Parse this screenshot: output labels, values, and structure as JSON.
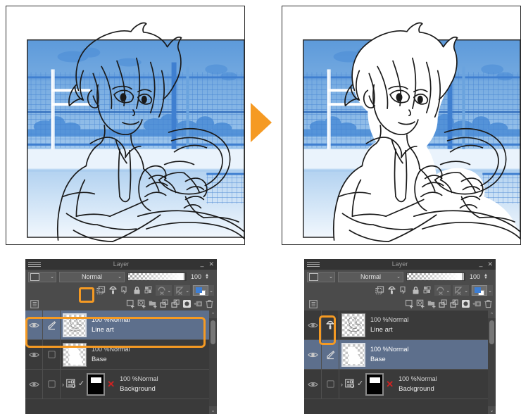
{
  "window": {
    "title": "Layer",
    "menu_icon": "hamburger-icon",
    "minimize_label": "–",
    "close_label": "✕"
  },
  "toolbar": {
    "blend_mode": "Normal",
    "opacity_value": "100",
    "chevron": "⌄",
    "row2_icons": [
      "lock-transparent-pixels-icon",
      "clipping-mask-icon",
      "layer-mask-link-icon",
      "lock-layer-icon",
      "lock-pixels-icon",
      "ruler-off-icon",
      "effect-off-icon",
      "draw-color-swatch-icon"
    ],
    "row3_icons": [
      "layer-list-icon",
      "new-raster-layer-icon",
      "new-tone-layer-icon",
      "new-folder-icon",
      "transfer-down-icon",
      "combine-down-icon",
      "layer-mask-icon",
      "add-mask-icon",
      "delete-layer-icon"
    ]
  },
  "layers": [
    {
      "opacity_mode": "100 %Normal",
      "name": "Line art",
      "visible": true,
      "mode_icon": "pen-icon",
      "selected": true,
      "thumb": "lineart"
    },
    {
      "opacity_mode": "100 %Normal",
      "name": "Base",
      "visible": true,
      "mode_icon": "empty-checkbox-icon",
      "selected": false,
      "thumb": "base"
    },
    {
      "opacity_mode": "100 %Normal",
      "name": "Background",
      "visible": true,
      "mode_icon": "empty-checkbox-icon",
      "selected": false,
      "thumb": "background",
      "expand_chevron": "›",
      "ref_icon": "reference-layer-icon",
      "check_mark": "✓",
      "red_x": "✕"
    }
  ],
  "layers_right": [
    {
      "opacity_mode": "100 %Normal",
      "name": "Line art",
      "visible": true,
      "mode_icon": "clipping-mask-icon",
      "selected": false,
      "thumb": "lineart"
    },
    {
      "opacity_mode": "100 %Normal",
      "name": "Base",
      "visible": true,
      "mode_icon": "pen-icon",
      "selected": true,
      "thumb": "base"
    },
    {
      "opacity_mode": "100 %Normal",
      "name": "Background",
      "visible": true,
      "mode_icon": "empty-checkbox-icon",
      "selected": false,
      "thumb": "background",
      "expand_chevron": "›",
      "ref_icon": "reference-layer-icon",
      "check_mark": "✓",
      "red_x": "✕"
    }
  ],
  "scrollbar": {
    "up": "⌃",
    "down": "⌄"
  },
  "highlights": {
    "left_toolbar_note": "clipping-mask-toolbar-button",
    "left_row_note": "line-art-layer-row",
    "right_row_note": "line-art-clipping-indicator"
  },
  "colors": {
    "accent_orange": "#f59a23",
    "panel_bg": "#4b4b4b",
    "list_bg": "#3a3a3a",
    "selected_row": "#5d6f8c",
    "title_bg": "#333333",
    "sky_blue": "#3f7fd0",
    "line_black": "#1a1a1a"
  },
  "illustrations": {
    "left_caption": "line-art-over-background",
    "right_caption": "base-fill-clipped-result"
  }
}
